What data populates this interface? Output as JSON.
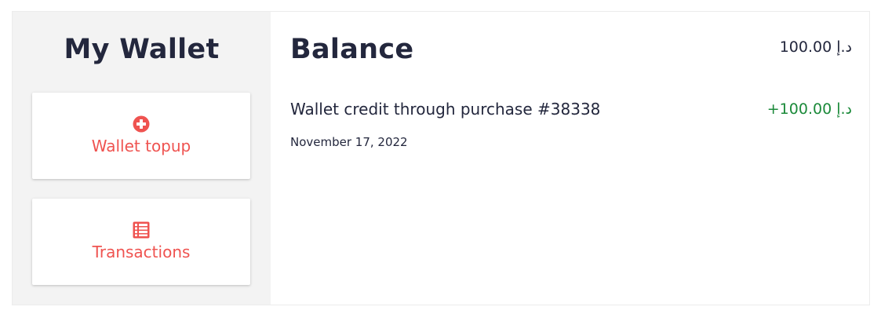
{
  "sidebar": {
    "title": "My Wallet",
    "topup": {
      "label": "Wallet topup",
      "icon": "plus-circle-icon"
    },
    "transactions": {
      "label": "Transactions",
      "icon": "list-icon"
    }
  },
  "main": {
    "title": "Balance",
    "balance": "100.00 د.إ",
    "transactions": [
      {
        "description": "Wallet credit through purchase #38338",
        "amount": "+100.00 د.إ",
        "date": "November 17, 2022"
      }
    ]
  },
  "colors": {
    "accent": "#ef5350",
    "heading": "#23273d",
    "credit": "#1b8a3a",
    "sidebar_bg": "#f3f3f3"
  }
}
